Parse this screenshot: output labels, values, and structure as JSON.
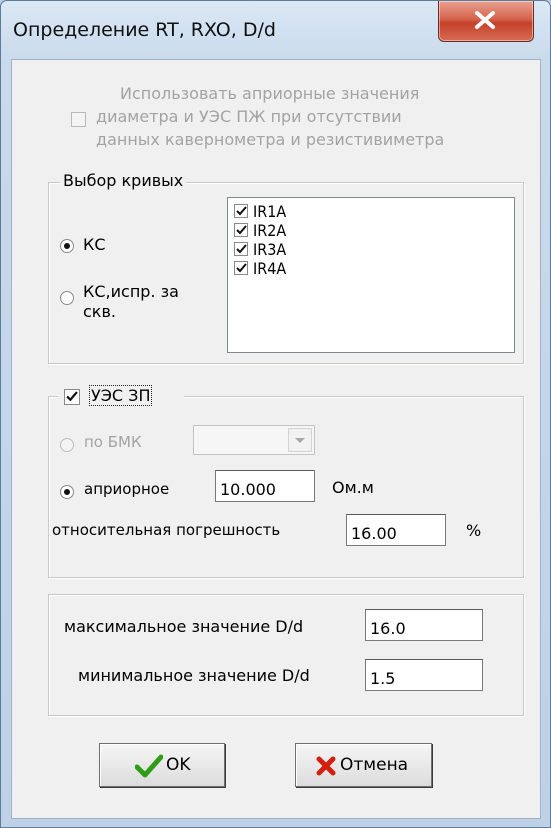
{
  "window": {
    "title": "Определение RT, RXO, D/d"
  },
  "apriori": {
    "checked": false,
    "enabled": false,
    "line1": "Использовать априорные значения",
    "line2": "диаметра и УЭС ПЖ при отсутствии",
    "line3": "данных кавернометра и резистивиметра"
  },
  "curves": {
    "group_label": "Выбор кривых",
    "radio_ks": {
      "label": "КС",
      "selected": true
    },
    "radio_ks_corr": {
      "line1": "КС,испр. за",
      "line2": "скв.",
      "selected": false
    },
    "list": [
      {
        "label": "IR1A",
        "checked": true
      },
      {
        "label": "IR2A",
        "checked": true
      },
      {
        "label": "IR3A",
        "checked": true
      },
      {
        "label": "IR4A",
        "checked": true
      }
    ]
  },
  "uez": {
    "group_label": "УЭС ЗП",
    "checked": true,
    "by_bmk": {
      "label": "по БМК",
      "selected": false,
      "enabled": false,
      "combo_value": ""
    },
    "apriori": {
      "label": "априорное",
      "selected": true,
      "value": "10.000",
      "unit": "Ом.м"
    },
    "rel_error": {
      "label": "относительная погрешность",
      "value": "16.00",
      "unit": "%"
    }
  },
  "dd": {
    "max": {
      "label": "максимальное значение D/d",
      "value": "16.0"
    },
    "min": {
      "label": "минимальное значение D/d",
      "value": "1.5"
    }
  },
  "buttons": {
    "ok": {
      "label": "OK",
      "icon": "checkmark-icon",
      "icon_color": "#2f9e16"
    },
    "cancel": {
      "label": "Отмена",
      "icon": "cross-icon",
      "icon_color": "#d2200f"
    }
  }
}
